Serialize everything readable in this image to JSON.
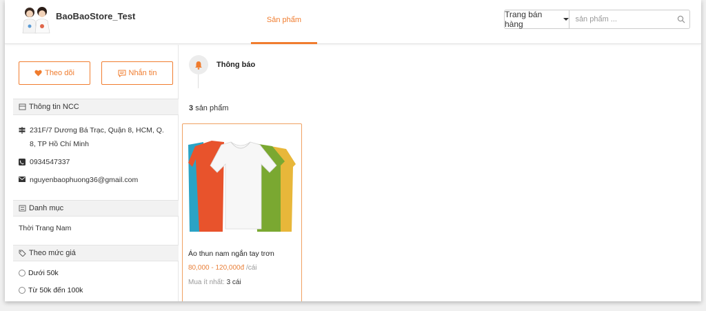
{
  "header": {
    "store_name": "BaoBaoStore_Test",
    "nav_tab": "Sản phẩm",
    "search_scope": "Trang bán hàng",
    "search_placeholder": "sản phẩm ...",
    "accent_color": "#f07c2e"
  },
  "sidebar": {
    "follow_label": "Theo dõi",
    "message_label": "Nhắn tin",
    "supplier_section": "Thông tin NCC",
    "address": "231F/7 Dương Bá Trạc, Quận 8, HCM, Q. 8, TP Hồ Chí Minh",
    "phone": "0934547337",
    "email": "nguyenbaophuong36@gmail.com",
    "category_section": "Danh mục",
    "category_item": "Thời Trang Nam",
    "price_section": "Theo mức giá",
    "price_options": [
      "Dưới 50k",
      "Từ 50k đến 100k"
    ]
  },
  "main": {
    "notice_title": "Thông báo",
    "product_count": "3",
    "product_count_suffix": "sản phẩm",
    "product": {
      "name": "Áo thun nam ngắn tay trơn",
      "price": "80,000 - 120,000đ",
      "price_unit": "/cái",
      "min_label": "Mua ít nhất:",
      "min_value": "3 cái"
    }
  }
}
